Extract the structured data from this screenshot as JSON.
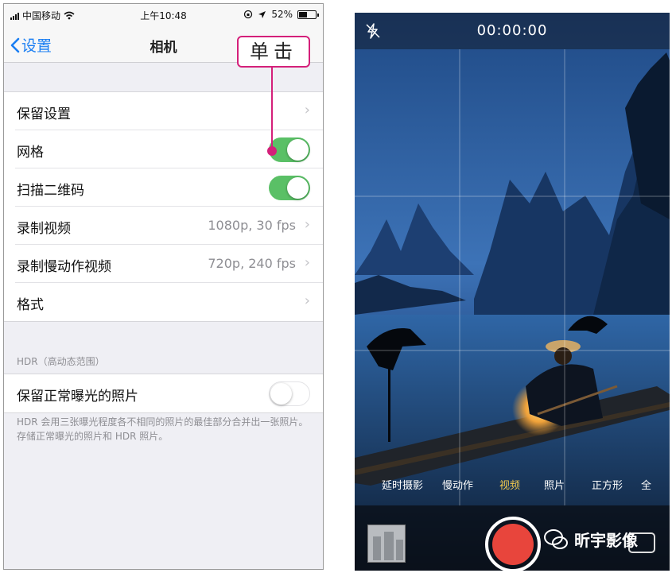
{
  "settings": {
    "status_bar": {
      "carrier": "中国移动",
      "time": "上午10:48",
      "battery": "52%",
      "battery_level": 0.52
    },
    "nav": {
      "back_label": "设置",
      "title": "相机"
    },
    "rows": [
      {
        "label": "保留设置",
        "value": "",
        "control": "chevron"
      },
      {
        "label": "网格",
        "control": "toggle",
        "on": true
      },
      {
        "label": "扫描二维码",
        "control": "toggle",
        "on": true
      },
      {
        "label": "录制视频",
        "value": "1080p, 30 fps",
        "control": "chevron"
      },
      {
        "label": "录制慢动作视频",
        "value": "720p, 240 fps",
        "control": "chevron"
      },
      {
        "label": "格式",
        "value": "",
        "control": "chevron"
      }
    ],
    "hdr": {
      "section_header": "HDR（高动态范围）",
      "row_label": "保留正常曝光的照片",
      "row_on": false,
      "footnote": "HDR 会用三张曝光程度各不相同的照片的最佳部分合并出一张照片。存储正常曝光的照片和 HDR 照片。"
    },
    "annotation": "单击",
    "colors": {
      "accent": "#1a7ef2",
      "toggle_on": "#5ac066",
      "annotation": "#d4207a"
    }
  },
  "camera": {
    "timer": "00:00:00",
    "modes": [
      "延时摄影",
      "慢动作",
      "视频",
      "照片",
      "正方形",
      "全"
    ],
    "active_mode": "视频",
    "icons": {
      "flash": "flash-off-icon",
      "flip": "camera-flip-icon",
      "shutter": "record-button"
    },
    "colors": {
      "record": "#e8453c",
      "active_mode": "#f2c94c"
    }
  },
  "watermark": "昕宇影像"
}
